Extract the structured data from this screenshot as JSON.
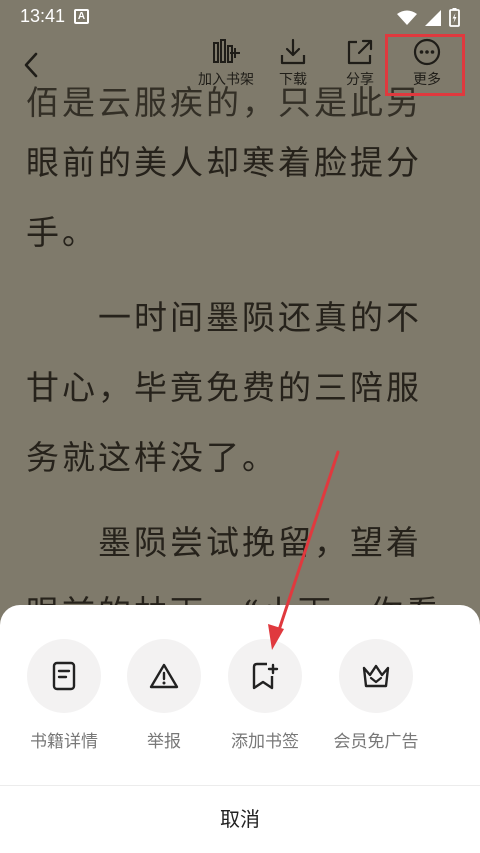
{
  "status_bar": {
    "time": "13:41",
    "notification_letter": "A"
  },
  "toolbar": {
    "add_to_shelf": "加入书架",
    "download": "下载",
    "share": "分享",
    "more": "更多"
  },
  "reader": {
    "lines": [
      "眼前的美人却寒着脸提分",
      "手。",
      "　　一时间墨陨还真的不",
      "甘心，毕竟免费的三陪服",
      "务就这样没了。",
      "　　墨陨尝试挽留，望着"
    ]
  },
  "bottom_sheet": {
    "actions": [
      {
        "label": "书籍详情",
        "icon": "book-details-icon"
      },
      {
        "label": "举报",
        "icon": "warning-icon"
      },
      {
        "label": "添加书签",
        "icon": "bookmark-add-icon"
      },
      {
        "label": "会员免广告",
        "icon": "vip-crown-icon"
      }
    ],
    "cancel": "取消"
  },
  "colors": {
    "highlight": "#e0393e",
    "reader_bg": "#7f7a6b",
    "text": "#26221b"
  }
}
